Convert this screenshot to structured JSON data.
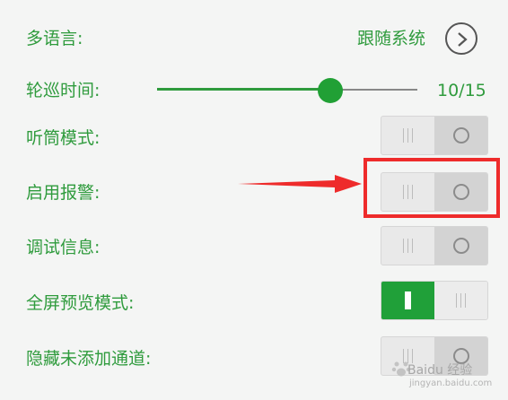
{
  "settings": {
    "language": {
      "label": "多语言:",
      "value": "跟随系统"
    },
    "patrol": {
      "label": "轮巡时间:",
      "value_text": "10/15",
      "current": 10,
      "max": 15
    },
    "earpiece": {
      "label": "听筒模式:",
      "on": false
    },
    "alarm": {
      "label": "启用报警:",
      "on": false
    },
    "debug": {
      "label": "调试信息:",
      "on": false
    },
    "fullscreen": {
      "label": "全屏预览模式:",
      "on": true
    },
    "hide_channels": {
      "label": "隐藏未添加通道:",
      "on": false
    }
  },
  "colors": {
    "accent": "#2f9b3d",
    "switch_on": "#20a039",
    "highlight": "#ee2b2b"
  },
  "icons": {
    "language_next": "chevron-right-icon"
  },
  "watermark": {
    "brand": "Baidu 经验",
    "url": "jingyan.baidu.com"
  }
}
